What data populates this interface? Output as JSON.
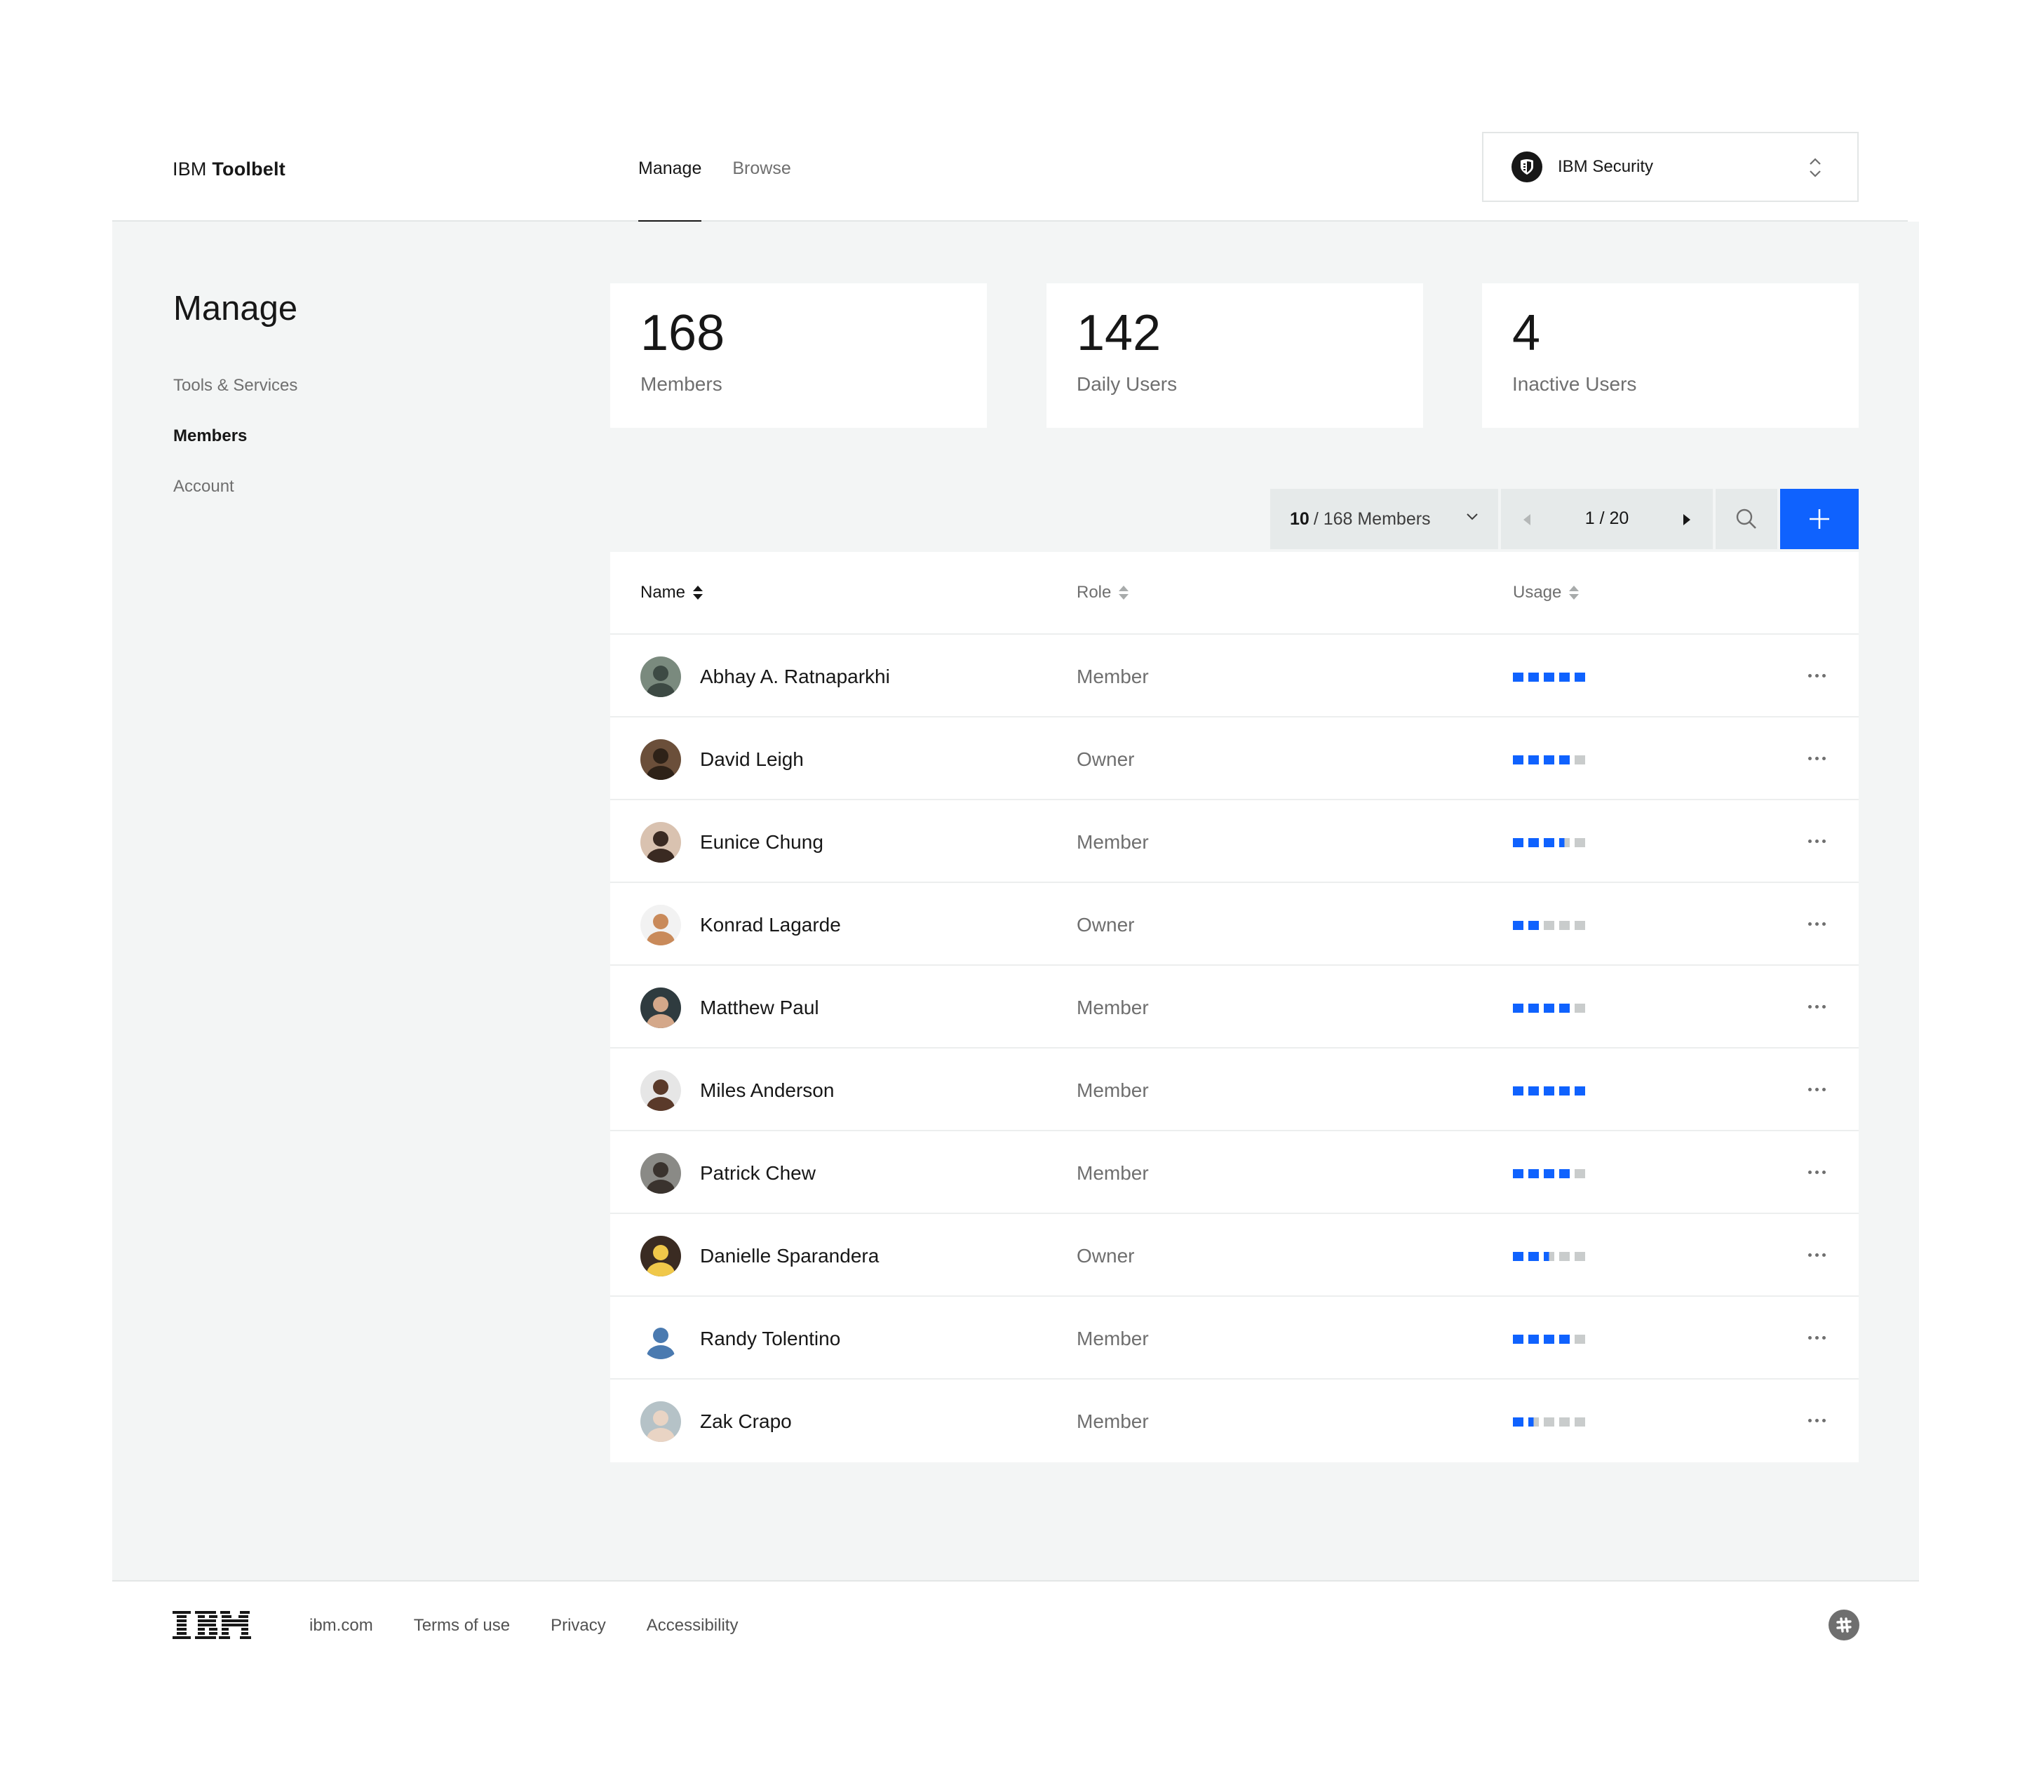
{
  "header": {
    "brand_prefix": "IBM",
    "brand_name": "Toolbelt",
    "tabs": [
      {
        "label": "Manage",
        "active": true
      },
      {
        "label": "Browse",
        "active": false
      }
    ],
    "org_switcher": {
      "label": "IBM Security",
      "icon": "shield-logo-icon"
    }
  },
  "sidebar": {
    "title": "Manage",
    "items": [
      {
        "label": "Tools & Services",
        "active": false
      },
      {
        "label": "Members",
        "active": true
      },
      {
        "label": "Account",
        "active": false
      }
    ]
  },
  "stats": [
    {
      "value": "168",
      "label": "Members"
    },
    {
      "value": "142",
      "label": "Daily Users"
    },
    {
      "value": "4",
      "label": "Inactive Users"
    }
  ],
  "toolbar": {
    "page_size": "10",
    "page_size_suffix": "/ 168 Members",
    "pager_text": "1 / 20",
    "search_icon": "search-icon",
    "add_icon": "plus-icon"
  },
  "table": {
    "columns": [
      "Name",
      "Role",
      "Usage"
    ],
    "rows": [
      {
        "name": "Abhay A. Ratnaparkhi",
        "role": "Member",
        "usage": 5
      },
      {
        "name": "David Leigh",
        "role": "Owner",
        "usage": 4
      },
      {
        "name": "Eunice Chung",
        "role": "Member",
        "usage": 3.5
      },
      {
        "name": "Konrad Lagarde",
        "role": "Owner",
        "usage": 2
      },
      {
        "name": "Matthew Paul",
        "role": "Member",
        "usage": 4
      },
      {
        "name": "Miles Anderson",
        "role": "Member",
        "usage": 5
      },
      {
        "name": "Patrick Chew",
        "role": "Member",
        "usage": 4
      },
      {
        "name": "Danielle Sparandera",
        "role": "Owner",
        "usage": 2.5
      },
      {
        "name": "Randy Tolentino",
        "role": "Member",
        "usage": 4
      },
      {
        "name": "Zak Crapo",
        "role": "Member",
        "usage": 1.5
      }
    ],
    "usage_max": 5
  },
  "footer": {
    "logo": "IBM",
    "links": [
      "ibm.com",
      "Terms of use",
      "Privacy",
      "Accessibility"
    ],
    "slack_icon": "slack-icon"
  },
  "colors": {
    "accent": "#0f62fe",
    "panel": "#f3f5f5",
    "text": "#171717",
    "muted": "#6f6f6f"
  }
}
